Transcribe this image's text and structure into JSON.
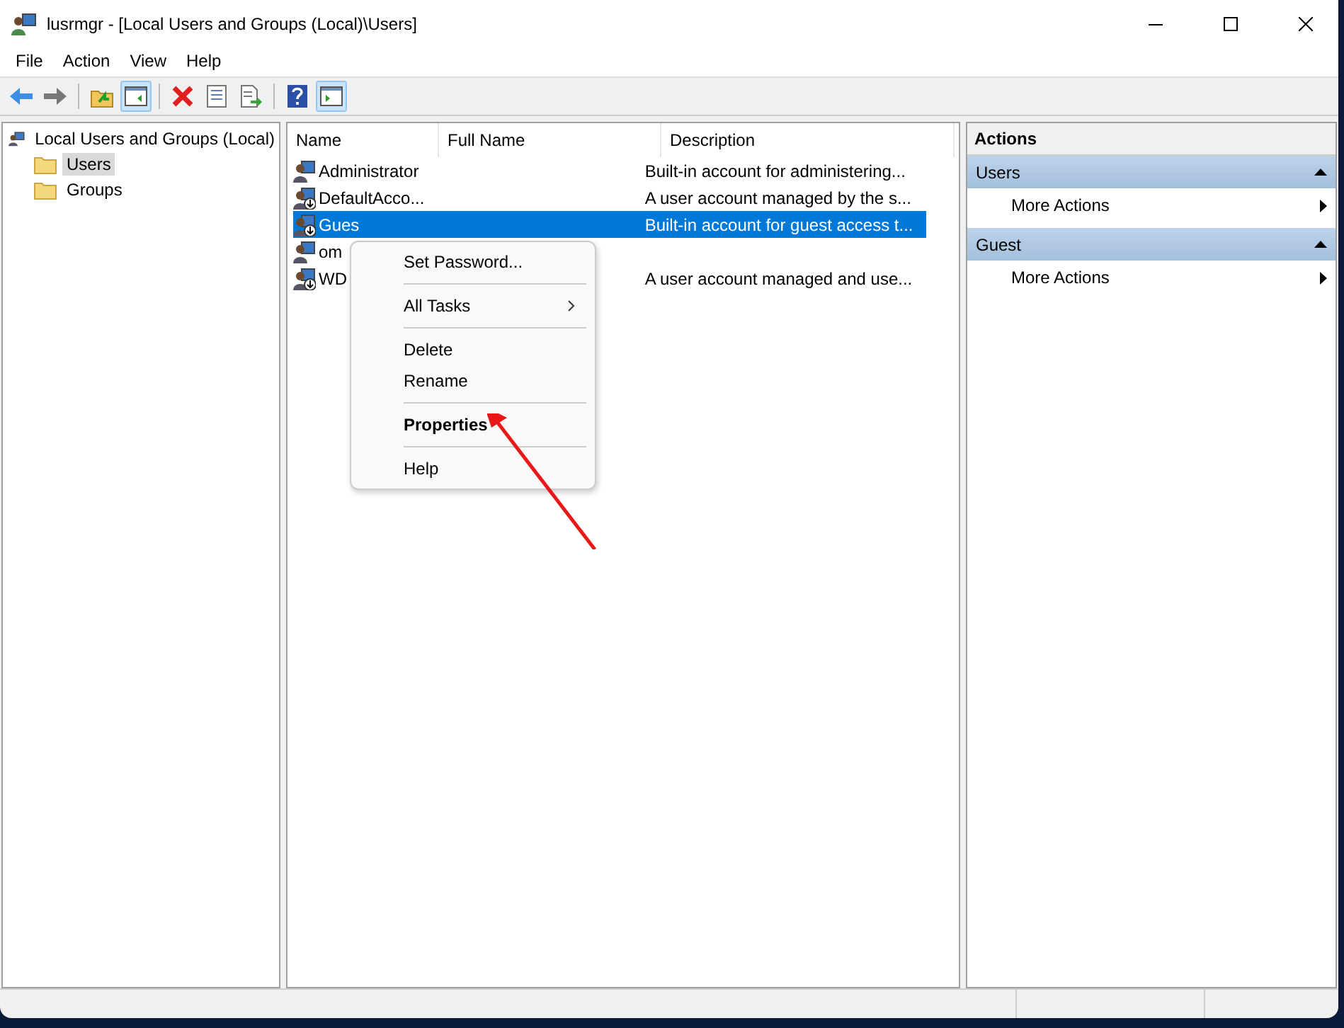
{
  "window": {
    "title": "lusrmgr - [Local Users and Groups (Local)\\Users]"
  },
  "menu": [
    "File",
    "Action",
    "View",
    "Help"
  ],
  "toolbar": [
    {
      "kind": "back",
      "pressed": false
    },
    {
      "kind": "forward",
      "pressed": false
    },
    {
      "kind": "sep"
    },
    {
      "kind": "up",
      "pressed": false
    },
    {
      "kind": "tree",
      "pressed": true
    },
    {
      "kind": "sep"
    },
    {
      "kind": "delete",
      "pressed": false
    },
    {
      "kind": "properties",
      "pressed": false
    },
    {
      "kind": "export",
      "pressed": false
    },
    {
      "kind": "sep"
    },
    {
      "kind": "help",
      "pressed": false
    },
    {
      "kind": "actionpane",
      "pressed": true
    }
  ],
  "tree": {
    "label": "Local Users and Groups (Local)",
    "children": [
      {
        "label": "Users",
        "selected": true
      },
      {
        "label": "Groups",
        "selected": false
      }
    ]
  },
  "table": {
    "columns": [
      "Name",
      "Full Name",
      "Description"
    ],
    "rows": [
      {
        "name": "Administrator",
        "full_name": "",
        "description": "Built-in account for administering...",
        "selected": false,
        "disabled": false
      },
      {
        "name": "DefaultAcco...",
        "full_name": "",
        "description": "A user account managed by the s...",
        "selected": false,
        "disabled": true
      },
      {
        "name": "Gues",
        "full_name": "",
        "description": "Built-in account for guest access t...",
        "selected": true,
        "disabled": true
      },
      {
        "name": "om",
        "full_name": "",
        "description": "",
        "selected": false,
        "disabled": false
      },
      {
        "name": "WD",
        "full_name": "",
        "description": "A user account managed and use...",
        "selected": false,
        "disabled": true
      }
    ]
  },
  "context_menu": [
    {
      "kind": "item",
      "label": "Set Password...",
      "bold": false
    },
    {
      "kind": "sep"
    },
    {
      "kind": "submenu",
      "label": "All Tasks",
      "bold": false
    },
    {
      "kind": "sep"
    },
    {
      "kind": "item",
      "label": "Delete",
      "bold": false
    },
    {
      "kind": "item",
      "label": "Rename",
      "bold": false
    },
    {
      "kind": "sep"
    },
    {
      "kind": "item",
      "label": "Properties",
      "bold": true
    },
    {
      "kind": "sep"
    },
    {
      "kind": "item",
      "label": "Help",
      "bold": false
    }
  ],
  "actions": {
    "title": "Actions",
    "sections": [
      {
        "label": "Users",
        "expanded": true,
        "items": [
          "More Actions"
        ]
      },
      {
        "label": "Guest",
        "expanded": true,
        "items": [
          "More Actions"
        ]
      }
    ]
  }
}
